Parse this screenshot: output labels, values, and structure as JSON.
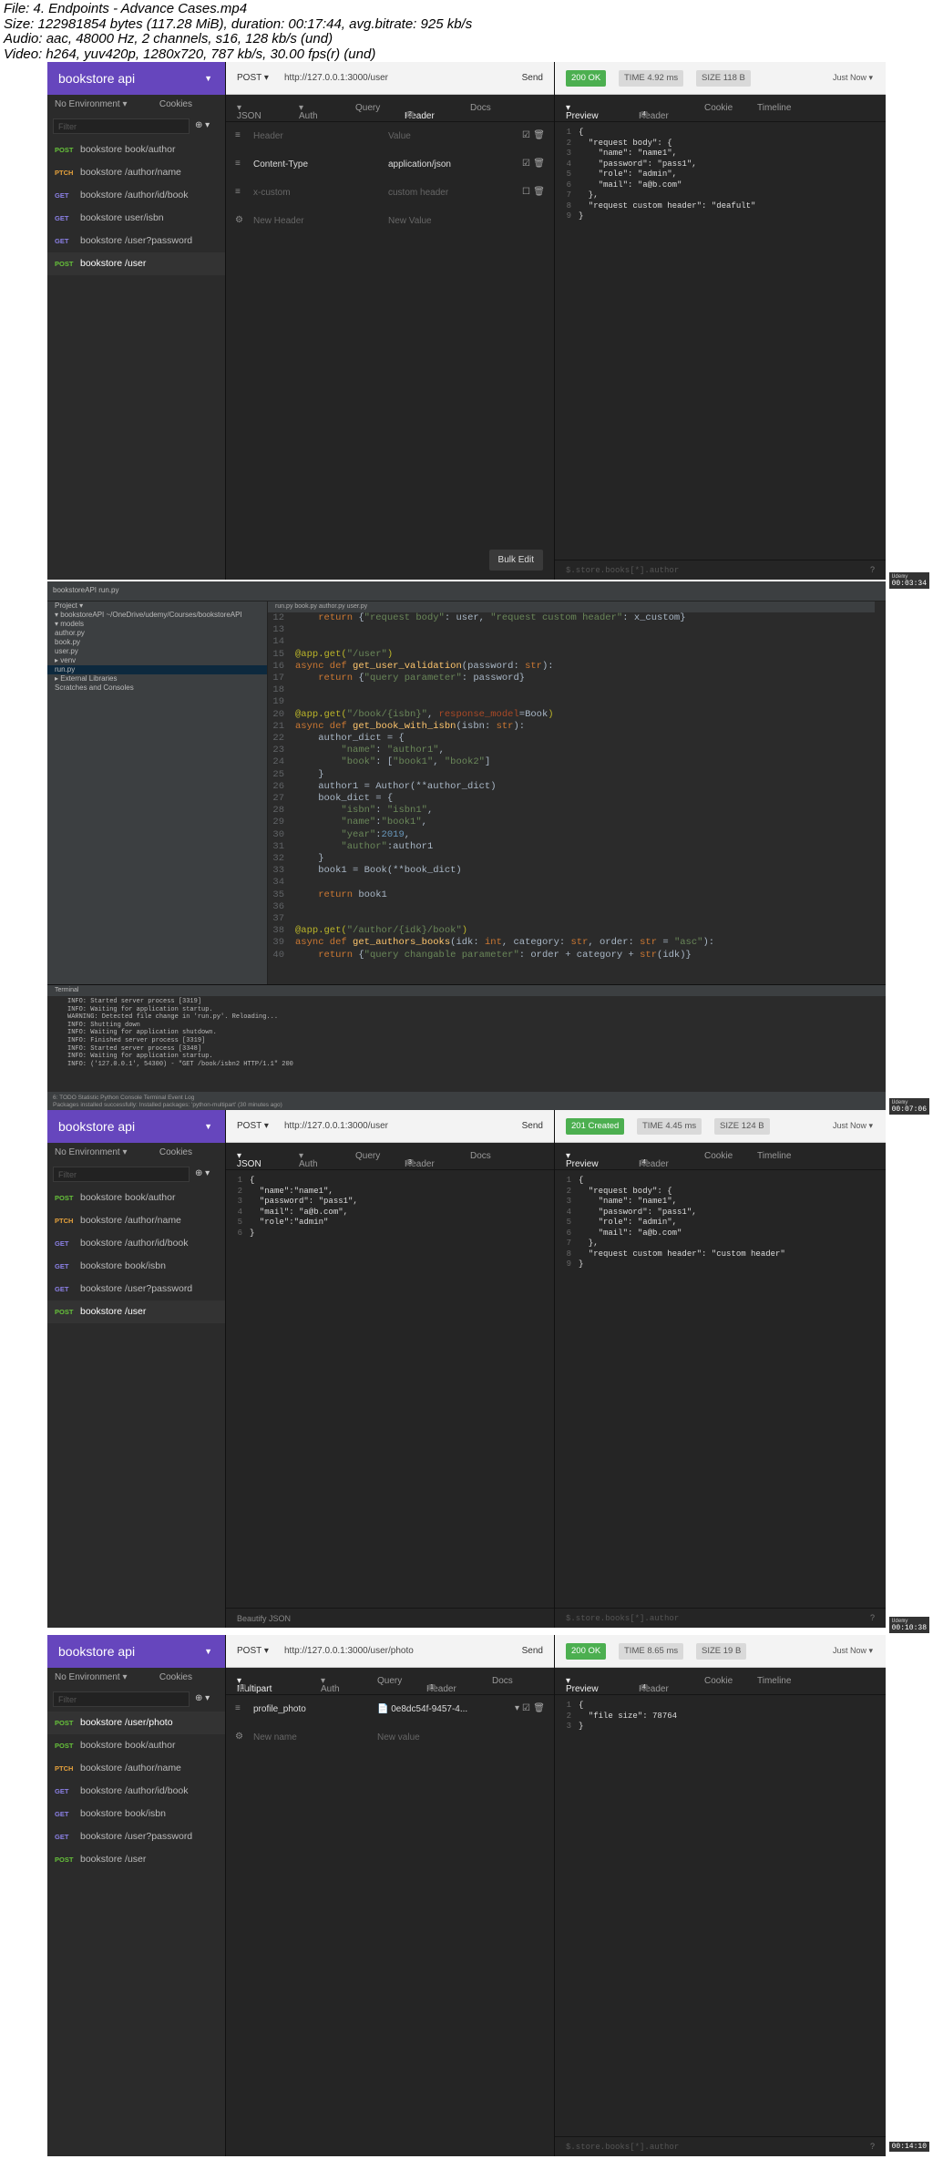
{
  "header": {
    "line1": "File: 4. Endpoints - Advance Cases.mp4",
    "line2": "Size: 122981854 bytes (117.28 MiB), duration: 00:17:44, avg.bitrate: 925 kb/s",
    "line3": "Audio: aac, 48000 Hz, 2 channels, s16, 128 kb/s (und)",
    "line4": "Video: h264, yuv420p, 1280x720, 787 kb/s, 30.00 fps(r) (und)"
  },
  "frame1": {
    "sidebar": {
      "title": "bookstore api",
      "env": "No Environment",
      "cookies": "Cookies",
      "filter": "Filter",
      "items": [
        {
          "m": "POST",
          "label": "bookstore book/author"
        },
        {
          "m": "PTCH",
          "label": "bookstore /author/name"
        },
        {
          "m": "GET",
          "label": "bookstore /author/id/book"
        },
        {
          "m": "GET",
          "label": "bookstore user/isbn"
        },
        {
          "m": "GET",
          "label": "bookstore /user?password"
        },
        {
          "m": "POST",
          "label": "bookstore /user"
        }
      ]
    },
    "method": "POST",
    "url": "http://127.0.0.1:3000/user",
    "send": "Send",
    "tabs": {
      "t1": "JSON",
      "t2": "Auth",
      "t3": "Query",
      "t4": "Header",
      "t4c": "2",
      "t5": "Docs"
    },
    "headers": [
      {
        "k": "Header",
        "v": "Value"
      },
      {
        "k": "Content-Type",
        "v": "application/json"
      },
      {
        "k": "x-custom",
        "v": "custom header"
      },
      {
        "k": "New Header",
        "v": "New Value"
      }
    ],
    "bulk": "Bulk Edit",
    "status": "200 OK",
    "time": "TIME 4.92 ms",
    "size": "SIZE 118 B",
    "when": "Just Now",
    "rtabs": {
      "r1": "Preview",
      "r2": "Header",
      "r2c": "4",
      "r3": "Cookie",
      "r4": "Timeline"
    },
    "response": [
      "{",
      "  \"request body\": {",
      "    \"name\": \"name1\",",
      "    \"password\": \"pass1\",",
      "    \"role\": \"admin\",",
      "    \"mail\": \"a@b.com\"",
      "  },",
      "  \"request custom header\": \"deafult\"",
      "}"
    ],
    "filterq": "$.store.books[*].author",
    "stamp": "00:03:34"
  },
  "ide": {
    "title": "bookstoreAPI  run.py",
    "tabs": "run.py    book.py    author.py    user.py",
    "tree": [
      "Project ▾",
      "▾ bookstoreAPI ~/OneDrive/udemy/Courses/bookstoreAPI",
      "  ▾ models",
      "      author.py",
      "      book.py",
      "      user.py",
      "  ▸ venv",
      "    run.py",
      "▸ External Libraries",
      "  Scratches and Consoles"
    ],
    "terminal": [
      "INFO: Started server process [3319]",
      "INFO: Waiting for application startup.",
      "WARNING: Detected file change in 'run.py'. Reloading...",
      "INFO: Shutting down",
      "INFO: Waiting for application shutdown.",
      "INFO: Finished server process [3319]",
      "INFO: Started server process [3348]",
      "INFO: Waiting for application startup.",
      "INFO: ('127.0.0.1', 54300) - \"GET /book/isbn2 HTTP/1.1\" 200"
    ],
    "term_label": "Terminal",
    "statusbar": "6: TODO   Statistic   Python Console   Terminal                                                   Event Log",
    "statusbar2": "Packages installed successfully: Installed packages: 'python-multipart' (30 minutes ago)",
    "stamp": "00:07:06"
  },
  "frame2": {
    "sidebar": {
      "title": "bookstore api",
      "env": "No Environment",
      "cookies": "Cookies",
      "filter": "Filter",
      "items": [
        {
          "m": "POST",
          "label": "bookstore book/author"
        },
        {
          "m": "PTCH",
          "label": "bookstore /author/name"
        },
        {
          "m": "GET",
          "label": "bookstore /author/id/book"
        },
        {
          "m": "GET",
          "label": "bookstore book/isbn"
        },
        {
          "m": "GET",
          "label": "bookstore /user?password"
        },
        {
          "m": "POST",
          "label": "bookstore /user"
        }
      ]
    },
    "method": "POST",
    "url": "http://127.0.0.1:3000/user",
    "send": "Send",
    "tabs": {
      "t1": "JSON",
      "t2": "Auth",
      "t3": "Query",
      "t4": "Header",
      "t4c": "3",
      "t5": "Docs"
    },
    "body": [
      "{",
      "  \"name\":\"name1\",",
      "  \"password\": \"pass1\",",
      "  \"mail\": \"a@b.com\",",
      "  \"role\":\"admin\"",
      "}"
    ],
    "beautify": "Beautify JSON",
    "status": "201 Created",
    "time": "TIME 4.45 ms",
    "size": "SIZE 124 B",
    "when": "Just Now",
    "rtabs": {
      "r1": "Preview",
      "r2": "Header",
      "r2c": "4",
      "r3": "Cookie",
      "r4": "Timeline"
    },
    "response": [
      "{",
      "  \"request body\": {",
      "    \"name\": \"name1\",",
      "    \"password\": \"pass1\",",
      "    \"role\": \"admin\",",
      "    \"mail\": \"a@b.com\"",
      "  },",
      "  \"request custom header\": \"custom header\"",
      "}"
    ],
    "filterq": "$.store.books[*].author",
    "stamp": "00:10:38"
  },
  "frame3": {
    "sidebar": {
      "title": "bookstore api",
      "env": "No Environment",
      "cookies": "Cookies",
      "filter": "Filter",
      "items": [
        {
          "m": "POST",
          "label": "bookstore /user/photo"
        },
        {
          "m": "POST",
          "label": "bookstore book/author"
        },
        {
          "m": "PTCH",
          "label": "bookstore /author/name"
        },
        {
          "m": "GET",
          "label": "bookstore /author/id/book"
        },
        {
          "m": "GET",
          "label": "bookstore book/isbn"
        },
        {
          "m": "GET",
          "label": "bookstore /user?password"
        },
        {
          "m": "POST",
          "label": "bookstore /user"
        }
      ]
    },
    "method": "POST",
    "url": "http://127.0.0.1:3000/user/photo",
    "send": "Send",
    "tabs": {
      "t1": "Multipart",
      "t1c": "1",
      "t2": "Auth",
      "t3": "Query",
      "t4": "Header",
      "t4c": "1",
      "t5": "Docs"
    },
    "field": {
      "name": "profile_photo",
      "file": "0e8dc54f-9457-4...",
      "newname": "New name",
      "newvalue": "New value"
    },
    "status": "200 OK",
    "time": "TIME 8.65 ms",
    "size": "SIZE 19 B",
    "when": "Just Now",
    "rtabs": {
      "r1": "Preview",
      "r2": "Header",
      "r2c": "4",
      "r3": "Cookie",
      "r4": "Timeline"
    },
    "response": [
      "{",
      "  \"file size\": 78764",
      "}"
    ],
    "filterq": "$.store.books[*].author",
    "stamp": "00:14:10"
  },
  "watermark": "Udemy"
}
